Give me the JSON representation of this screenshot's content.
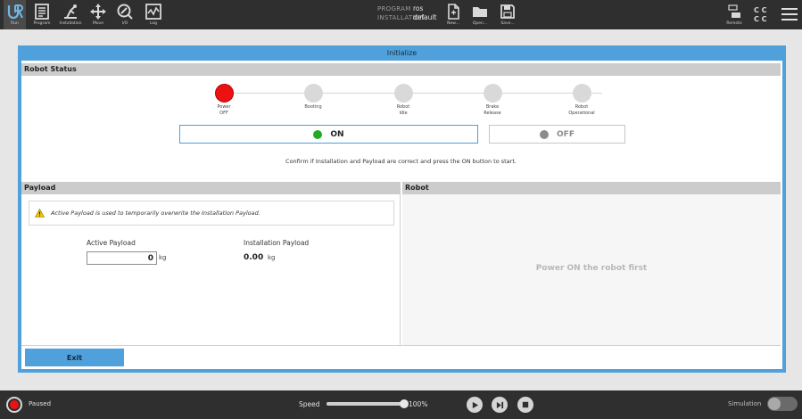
{
  "toolbar": {
    "tabs": [
      {
        "label": "Run",
        "icon": "ur-logo-icon"
      },
      {
        "label": "Program",
        "icon": "program-icon"
      },
      {
        "label": "Installation",
        "icon": "installation-icon"
      },
      {
        "label": "Move",
        "icon": "move-icon"
      },
      {
        "label": "I/O",
        "icon": "io-icon"
      },
      {
        "label": "Log",
        "icon": "log-icon"
      }
    ],
    "program_key": "PROGRAM",
    "program_value": "ros",
    "installation_key": "INSTALLATION",
    "installation_value": "default",
    "file_actions": [
      {
        "label": "New...",
        "icon": "new-file-icon"
      },
      {
        "label": "Open...",
        "icon": "folder-icon"
      },
      {
        "label": "Save...",
        "icon": "save-icon"
      }
    ],
    "remote_label": "Remote",
    "icons": {
      "remote": "remote-control-icon",
      "cc": "safety-checksum-icon",
      "menu": "hamburger-menu-icon"
    }
  },
  "dialog": {
    "title": "Initialize",
    "robot_status_header": "Robot Status",
    "steps": [
      {
        "label": "Power\nOFF",
        "state": "active",
        "color": "#ee1111"
      },
      {
        "label": "Booting",
        "state": "inactive",
        "color": "#d9d9d9"
      },
      {
        "label": "Robot\nIdle",
        "state": "inactive",
        "color": "#d9d9d9"
      },
      {
        "label": "Brake\nRelease",
        "state": "inactive",
        "color": "#d9d9d9"
      },
      {
        "label": "Robot\nOperational",
        "state": "inactive",
        "color": "#d9d9d9"
      }
    ],
    "on_button": {
      "label": "ON",
      "led_color": "#22aa22"
    },
    "off_button": {
      "label": "OFF",
      "led_color": "#8c8c8c"
    },
    "confirm_text": "Confirm if Installation and Payload are correct and press the ON button to start.",
    "payload": {
      "header": "Payload",
      "warning": "Active Payload is used to temporarily overwrite the Installation Payload.",
      "active_label": "Active Payload",
      "active_value": "0",
      "active_unit": "kg",
      "installation_label": "Installation Payload",
      "installation_value": "0.00",
      "installation_unit": "kg"
    },
    "robot": {
      "header": "Robot",
      "message": "Power ON the robot first"
    },
    "exit_label": "Exit"
  },
  "footer": {
    "status": "Paused",
    "speed_label": "Speed",
    "speed_value": "100%",
    "speed_fraction": 1.0,
    "simulation_label": "Simulation",
    "simulation_on": false
  },
  "colors": {
    "accent": "#4fa0db",
    "error": "#ee1111",
    "ok": "#22aa22"
  }
}
